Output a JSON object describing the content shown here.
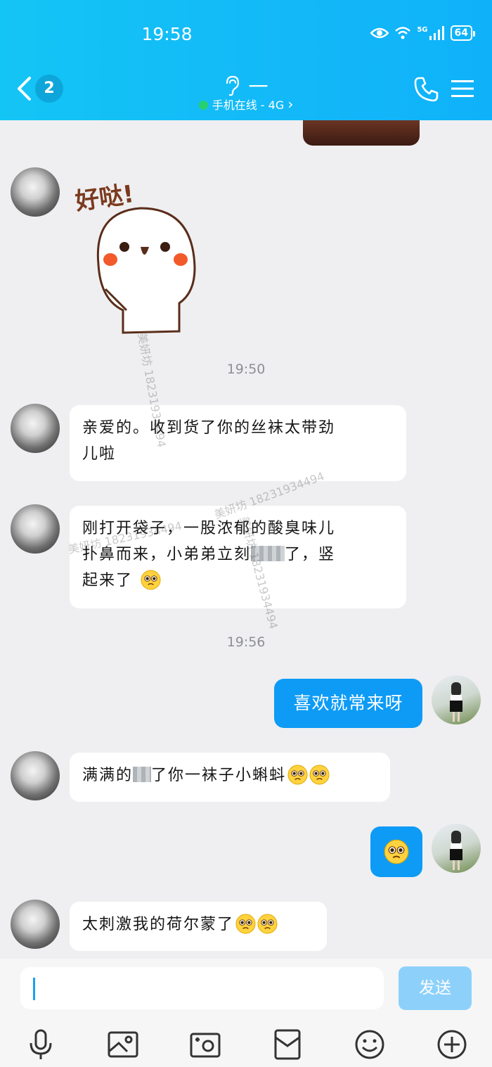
{
  "status_bar": {
    "time": "19:58",
    "network": "5G",
    "battery": "64"
  },
  "header": {
    "unread_count": "2",
    "contact_name": "一",
    "online_status": "手机在线 - 4G",
    "online_chevron": "›"
  },
  "sticker": {
    "text": "好哒!"
  },
  "messages": [
    {
      "time": "19:50"
    },
    {
      "text_line1": "亲爱的。收到货了你的丝袜太带劲",
      "text_line2": "儿啦"
    },
    {
      "text_line1": "刚打开袋子，一股浓郁的酸臭味儿",
      "text_line2a": "扑鼻而来，小弟弟立刻",
      "text_line2b": "了，竖",
      "text_line3": "起来了"
    },
    {
      "time": "19:56"
    },
    {
      "text": "喜欢就常来呀"
    },
    {
      "text_a": "满满的",
      "text_b": "了你一袜子小蝌蚪"
    },
    {
      "text": "太刺激我的荷尔蒙了"
    }
  ],
  "input": {
    "placeholder": "",
    "send_label": "发送"
  },
  "watermark": {
    "text": "美妍坊 18231934494"
  },
  "colors": {
    "header": "#13c5f5",
    "bubble_sent": "#0d9bf6",
    "send_disabled": "#8dd1fb",
    "online": "#27d06e"
  },
  "icons": [
    "back-icon",
    "ear-icon",
    "phone-icon",
    "menu-icon",
    "mic-icon",
    "image-icon",
    "camera-icon",
    "red-packet-icon",
    "emoji-icon",
    "plus-icon"
  ]
}
